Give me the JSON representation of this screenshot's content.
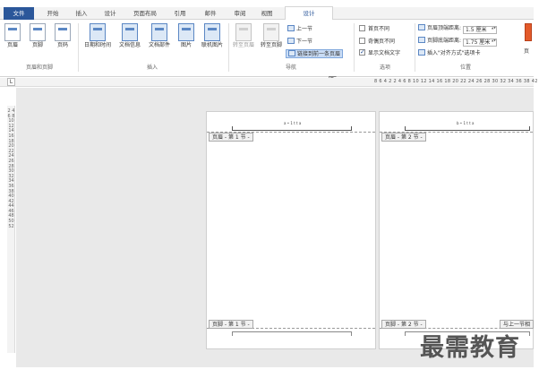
{
  "tabs": [
    {
      "label": "文件"
    },
    {
      "label": "开始"
    },
    {
      "label": "插入"
    },
    {
      "label": "设计"
    },
    {
      "label": "页面布局"
    },
    {
      "label": "引用"
    },
    {
      "label": "邮件"
    },
    {
      "label": "审阅"
    },
    {
      "label": "视图"
    },
    {
      "label": "设计"
    }
  ],
  "ribbon": {
    "header_footer": {
      "label": "页眉和页脚",
      "header": "页眉",
      "footer": "页脚",
      "page_number": "页码"
    },
    "insert": {
      "label": "插入",
      "date_time": "日期和时间",
      "doc_info": "文档信息",
      "doc_parts": "文档部件",
      "picture": "图片",
      "online_picture": "联机图片"
    },
    "navigation": {
      "label": "导航",
      "goto_header": "转至页眉",
      "goto_footer": "转至页脚",
      "prev_section": "上一节",
      "next_section": "下一节",
      "link_previous": "链接到前一条页眉"
    },
    "options": {
      "label": "选项",
      "different_first": "首页不同",
      "different_odd_even": "奇偶页不同",
      "show_doc_text": "显示文档文字",
      "show_doc_text_checked": true
    },
    "position": {
      "label": "位置",
      "header_from_top": "页眉顶端距离:",
      "header_from_top_value": "1.5 厘米",
      "footer_from_bottom": "页脚底端距离:",
      "footer_from_bottom_value": "1.75 厘米",
      "insert_align_tab": "插入\"对齐方式\"选项卡"
    },
    "close_partial": "页"
  },
  "ruler": {
    "corner": "L",
    "text": "8 6 4 2 2 4 6 8 10 12 14 16 18 20 22 24 26 28 30 32 34 36 38 42",
    "vertical": "2 4 6 8 10 12 14 16 18 20 22 24 26 28 30 32 34 36 38 40 42 44 46 48 50 52"
  },
  "document": {
    "page1": {
      "header_tag": "页眉 - 第 1 节 -",
      "header_text": "a • 1 t t a",
      "footer_tag": "页脚 - 第 1 节 -"
    },
    "page2": {
      "header_tag": "页眉 - 第 2 节 -",
      "header_text": "b • 1 t t a",
      "footer_tag": "页脚 - 第 2 节 -",
      "same_as_previous": "与上一节相"
    }
  },
  "watermark": "最需教育",
  "colors": {
    "file_tab": "#2b579a",
    "accent": "#2b579a",
    "highlight": "#c9dcf5"
  }
}
